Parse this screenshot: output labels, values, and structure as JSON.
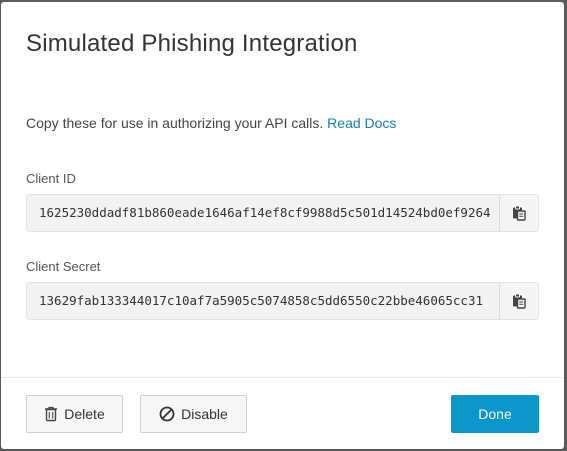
{
  "modal": {
    "title": "Simulated Phishing Integration",
    "intro_text": "Copy these for use in authorizing your API calls.",
    "intro_link": "Read Docs"
  },
  "fields": {
    "client_id": {
      "label": "Client ID",
      "value": "1625230ddadf81b860eade1646af14ef8cf9988d5c501d14524bd0ef9264"
    },
    "client_secret": {
      "label": "Client Secret",
      "value": "13629fab133344017c10af7a5905c5074858c5dd6550c22bbe46065cc31"
    }
  },
  "footer": {
    "delete_label": "Delete",
    "disable_label": "Disable",
    "done_label": "Done"
  },
  "icons": {
    "copy": "clipboard-icon",
    "delete": "trash-icon",
    "disable": "ban-icon"
  },
  "colors": {
    "link": "#1b7bb5",
    "primary": "#0b96c9"
  }
}
